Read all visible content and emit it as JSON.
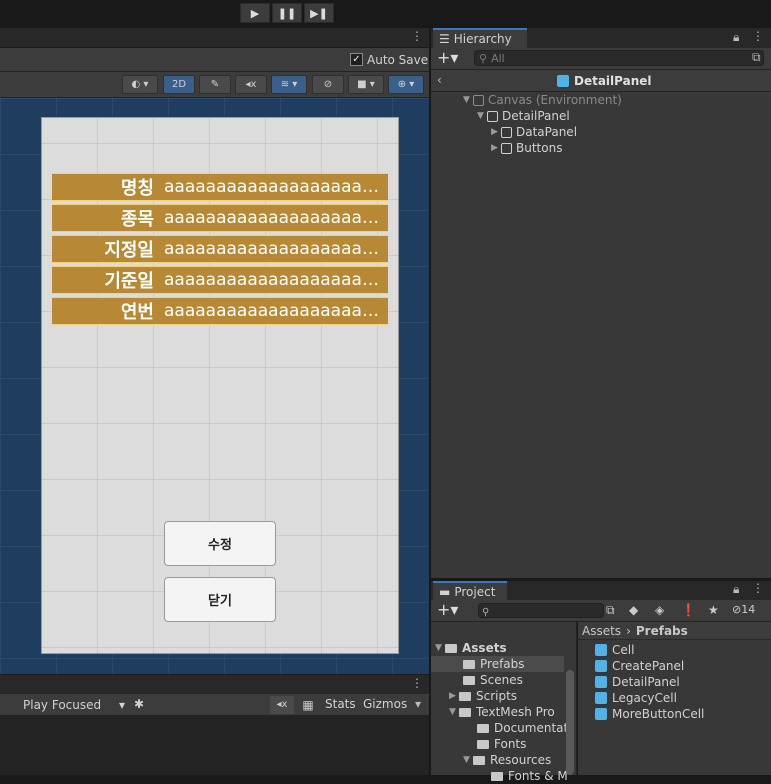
{
  "toolbar": {
    "play_icon": "play-icon",
    "pause_icon": "pause-icon",
    "step_icon": "step-icon"
  },
  "scene": {
    "auto_save_label": "Auto Save",
    "auto_save_checked": true,
    "mode_2d_label": "2D"
  },
  "canvas": {
    "rows": [
      {
        "label": "명칭",
        "value": "aaaaaaaaaaaaaaaaaaaaaaaaaaaa"
      },
      {
        "label": "종목",
        "value": "aaaaaaaaaaaaaaaaaaaaaaaaaaaa"
      },
      {
        "label": "지정일",
        "value": "aaaaaaaaaaaaaaaaaaaaaaaaaaaa"
      },
      {
        "label": "기준일",
        "value": "aaaaaaaaaaaaaaaaaaaaaaaaaaaa"
      },
      {
        "label": "연번",
        "value": "aaaaaaaaaaaaaaaaaaaaaaaaaaaa"
      }
    ],
    "edit_button": "수정",
    "close_button": "닫기"
  },
  "game": {
    "play_focused_label": "Play Focused",
    "stats_label": "Stats",
    "gizmos_label": "Gizmos"
  },
  "hierarchy": {
    "tab_label": "Hierarchy",
    "search_placeholder": "All",
    "header_title": "DetailPanel",
    "items": [
      {
        "label": "Canvas (Environment)"
      },
      {
        "label": "DetailPanel"
      },
      {
        "label": "DataPanel"
      },
      {
        "label": "Buttons"
      }
    ]
  },
  "project": {
    "tab_label": "Project",
    "hidden_count": "14",
    "breadcrumb_root": "Assets",
    "breadcrumb_current": "Prefabs",
    "tree": [
      {
        "label": "Assets"
      },
      {
        "label": "Prefabs"
      },
      {
        "label": "Scenes"
      },
      {
        "label": "Scripts"
      },
      {
        "label": "TextMesh Pro"
      },
      {
        "label": "Documentat"
      },
      {
        "label": "Fonts"
      },
      {
        "label": "Resources"
      },
      {
        "label": "Fonts & M"
      }
    ],
    "files": [
      {
        "label": "Cell"
      },
      {
        "label": "CreatePanel"
      },
      {
        "label": "DetailPanel"
      },
      {
        "label": "LegacyCell"
      },
      {
        "label": "MoreButtonCell"
      }
    ]
  }
}
